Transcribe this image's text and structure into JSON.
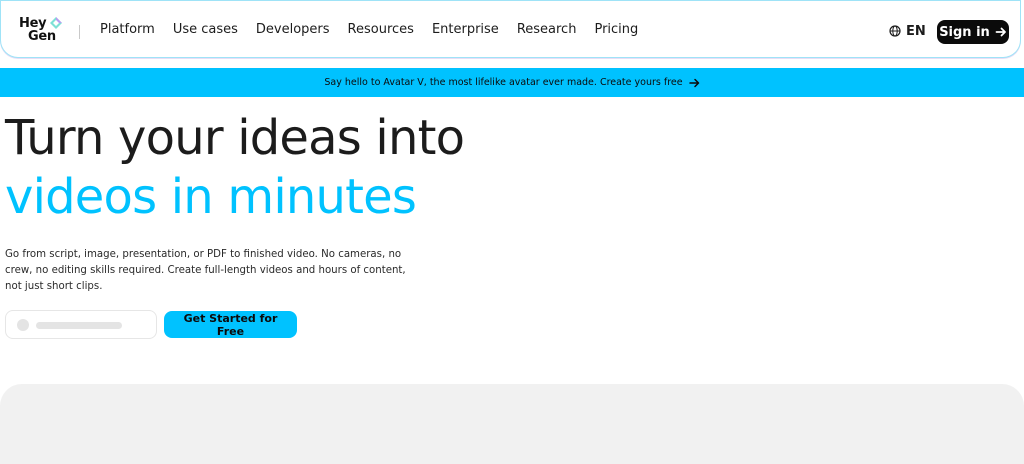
{
  "brand": {
    "logo_line1": "Hey",
    "logo_line2": "Gen"
  },
  "nav": {
    "items": [
      "Platform",
      "Use cases",
      "Developers",
      "Resources",
      "Enterprise",
      "Research",
      "Pricing"
    ],
    "language": "EN",
    "signin_label": "Sign in"
  },
  "banner": {
    "text": "Say hello to Avatar V, the most lifelike avatar ever made. Create yours free"
  },
  "hero": {
    "title_line1": "Turn your ideas into",
    "title_line2": "videos in minutes",
    "subtitle": "Go from script, image, presentation, or PDF to finished video. No cameras, no crew, no editing skills required. Create full-length videos and hours of content, not just short clips.",
    "cta_label": "Get Started for Free"
  },
  "colors": {
    "accent": "#00c2ff",
    "dark": "#0b0b0b",
    "panel": "#f1f1f1"
  },
  "icons": [
    "globe-icon",
    "arrow-right-icon",
    "logo-gem-icon"
  ]
}
